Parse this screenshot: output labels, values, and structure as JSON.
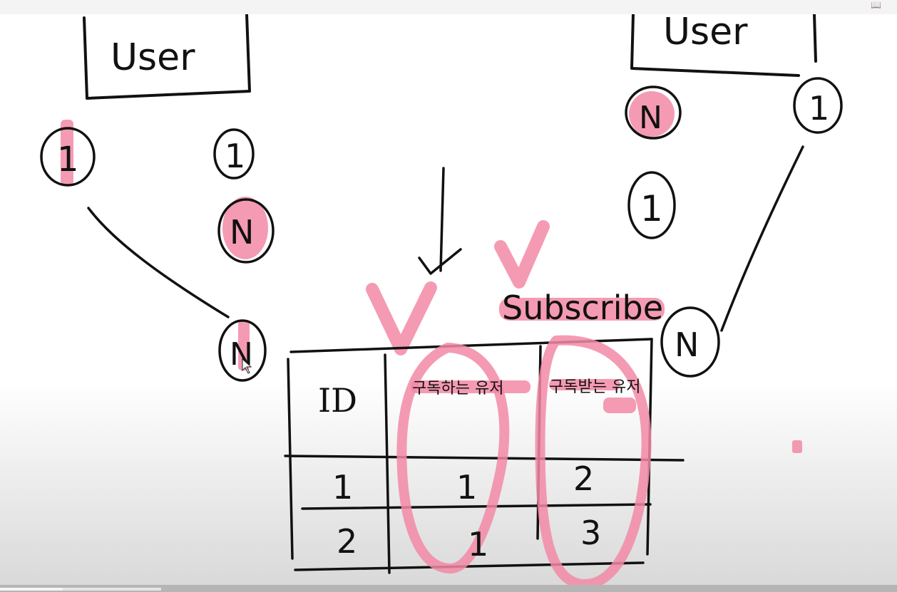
{
  "corner_icon": "book-open-icon",
  "left_diagram": {
    "entity": "User",
    "card_left": "1",
    "card_right_top": "1",
    "card_right_mid": "N",
    "card_bottom": "N"
  },
  "right_diagram": {
    "entity": "User",
    "card_left": "N",
    "card_right": "1",
    "card_mid": "1",
    "card_bottom": "N"
  },
  "table": {
    "label": "Subscribe",
    "headers": [
      "ID",
      "구독하는 유저",
      "구독받는 유저"
    ],
    "rows": [
      [
        "1",
        "1",
        "2"
      ],
      [
        "2",
        "1",
        "3"
      ]
    ]
  },
  "annotations": {
    "check_1": "V",
    "check_2": "V"
  },
  "colors": {
    "ink": "#111111",
    "highlight": "#f28aa6"
  },
  "video_progress": {
    "played_fraction": 0.07,
    "buffered_fraction": 0.18
  }
}
